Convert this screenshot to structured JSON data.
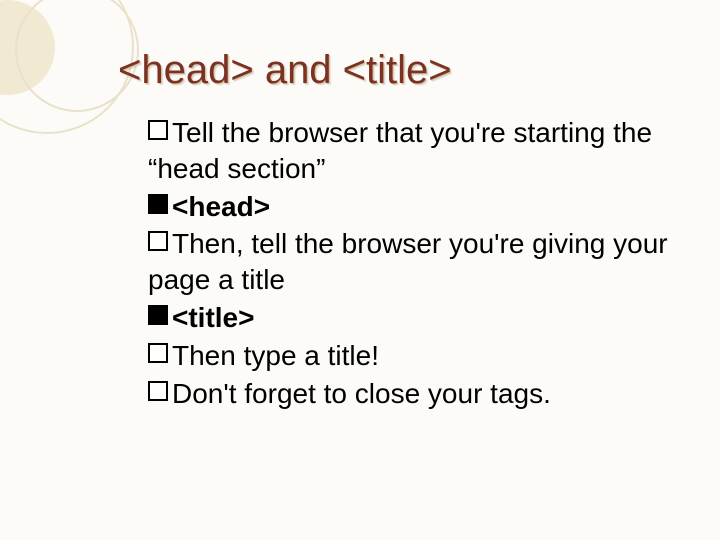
{
  "title": "<head> and <title>",
  "bullets": [
    {
      "filled": false,
      "bold": false,
      "text": "Tell the browser that you're starting the “head section”"
    },
    {
      "filled": true,
      "bold": true,
      "text": "<head>"
    },
    {
      "filled": false,
      "bold": false,
      "text": "Then, tell the browser you're giving your page a title"
    },
    {
      "filled": true,
      "bold": true,
      "text": "<title>"
    },
    {
      "filled": false,
      "bold": false,
      "text": "Then type a title!"
    },
    {
      "filled": false,
      "bold": false,
      "text": "Don't forget to close your tags."
    }
  ]
}
